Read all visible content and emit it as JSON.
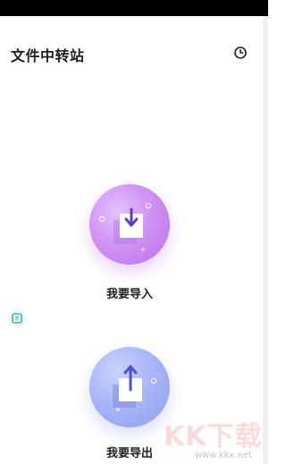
{
  "header": {
    "title": "文件中转站",
    "history_icon": "clock-icon"
  },
  "actions": {
    "import": {
      "label": "我要导入",
      "icon": "download-tray-icon",
      "color": "#c986f2"
    },
    "export": {
      "label": "我要导出",
      "icon": "upload-tray-icon",
      "color": "#9dabf4"
    }
  },
  "side_float": {
    "icon": "floating-tool-icon"
  },
  "watermark": {
    "brand": "KK下载",
    "url": "www.kkx.net"
  }
}
